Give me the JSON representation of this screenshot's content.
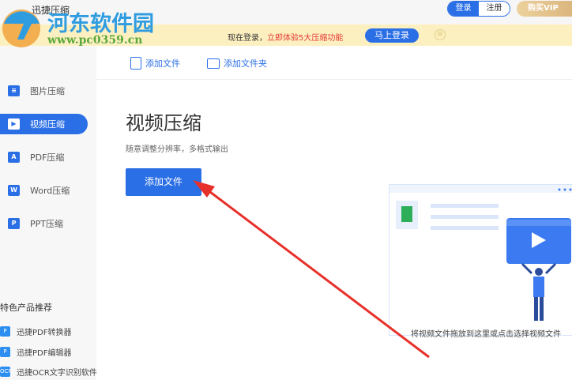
{
  "app": {
    "title": "迅捷压缩",
    "login": "登录",
    "register": "注册",
    "vip": "购买VIP"
  },
  "banner": {
    "text": "现在登录，",
    "highlight": "立即体验5大压缩功能",
    "button": "马上登录",
    "close": "⊗"
  },
  "sidebar": {
    "items": [
      {
        "label": "图片压缩",
        "icon": "image-icon",
        "glyph": "≡"
      },
      {
        "label": "视频压缩",
        "icon": "video-icon",
        "glyph": "▶"
      },
      {
        "label": "PDF压缩",
        "icon": "pdf-icon",
        "glyph": "A"
      },
      {
        "label": "Word压缩",
        "icon": "word-icon",
        "glyph": "W"
      },
      {
        "label": "PPT压缩",
        "icon": "ppt-icon",
        "glyph": "P"
      }
    ],
    "active": 1,
    "recommend_title": "特色产品推荐",
    "recommend": [
      {
        "label": "迅捷PDF转换器",
        "glyph": "P"
      },
      {
        "label": "迅捷PDF编辑器",
        "glyph": "P"
      },
      {
        "label": "迅捷OCR文字识别软件",
        "glyph": "OCR"
      }
    ]
  },
  "toolbar": {
    "add_file": "添加文件",
    "add_folder": "添加文件夹"
  },
  "main": {
    "title": "视频压缩",
    "subtitle": "随意调整分辨率，多格式输出",
    "add_button": "添加文件",
    "drop_caption": "将视频文件拖放到这里或点击选择视频文件"
  },
  "watermark": {
    "name": "河东软件园",
    "url": "www.pc0359.cn"
  },
  "colors": {
    "accent": "#2b6fe6",
    "banner": "#fdf0c0",
    "arrow": "#e8302a"
  }
}
